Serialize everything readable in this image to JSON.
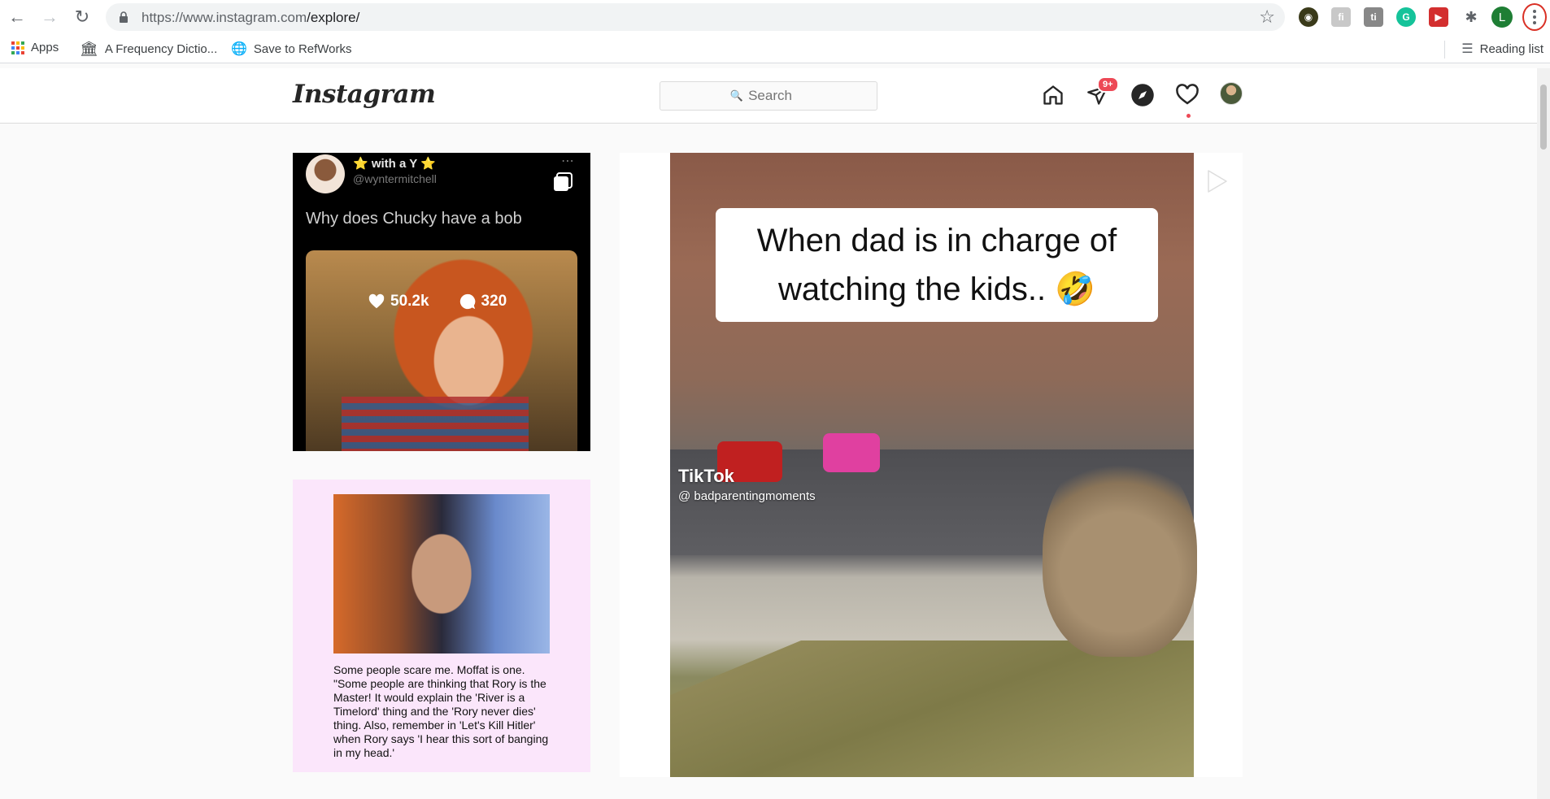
{
  "browser": {
    "url_host": "https://www.instagram.com",
    "url_path": "/explore/",
    "bookmarks": [
      {
        "label": "Apps"
      },
      {
        "label": "A Frequency Dictio..."
      },
      {
        "label": "Save to RefWorks"
      }
    ],
    "reading_list": "Reading list",
    "profile_initial": "L",
    "extensions": [
      "extension-1",
      "extension-2",
      "extension-3",
      "grammarly",
      "extension-red",
      "puzzle"
    ]
  },
  "instagram": {
    "logo": "Instagram",
    "search_placeholder": "Search",
    "messages_badge": "9+",
    "accent": "#ed4956"
  },
  "explore": {
    "tile1": {
      "name": "⭐ with a Y ⭐",
      "handle": "@wyntermitchell",
      "tweet_text": "Why does Chucky have a bob",
      "likes": "50.2k",
      "comments": "320"
    },
    "tile2": {
      "text": "Some people scare me. Moffat is one. \"Some people are thinking that Rory is the Master! It would explain the 'River is a Timelord' thing and the 'Rory never dies' thing. Also, remember in 'Let's Kill Hitler' when Rory says 'I hear this sort of banging in my head.'"
    },
    "tile3": {
      "caption": "When dad is in charge of watching the kids.. 🤣",
      "watermark": "TikTok",
      "watermark_handle": "@ badparentingmoments"
    }
  }
}
